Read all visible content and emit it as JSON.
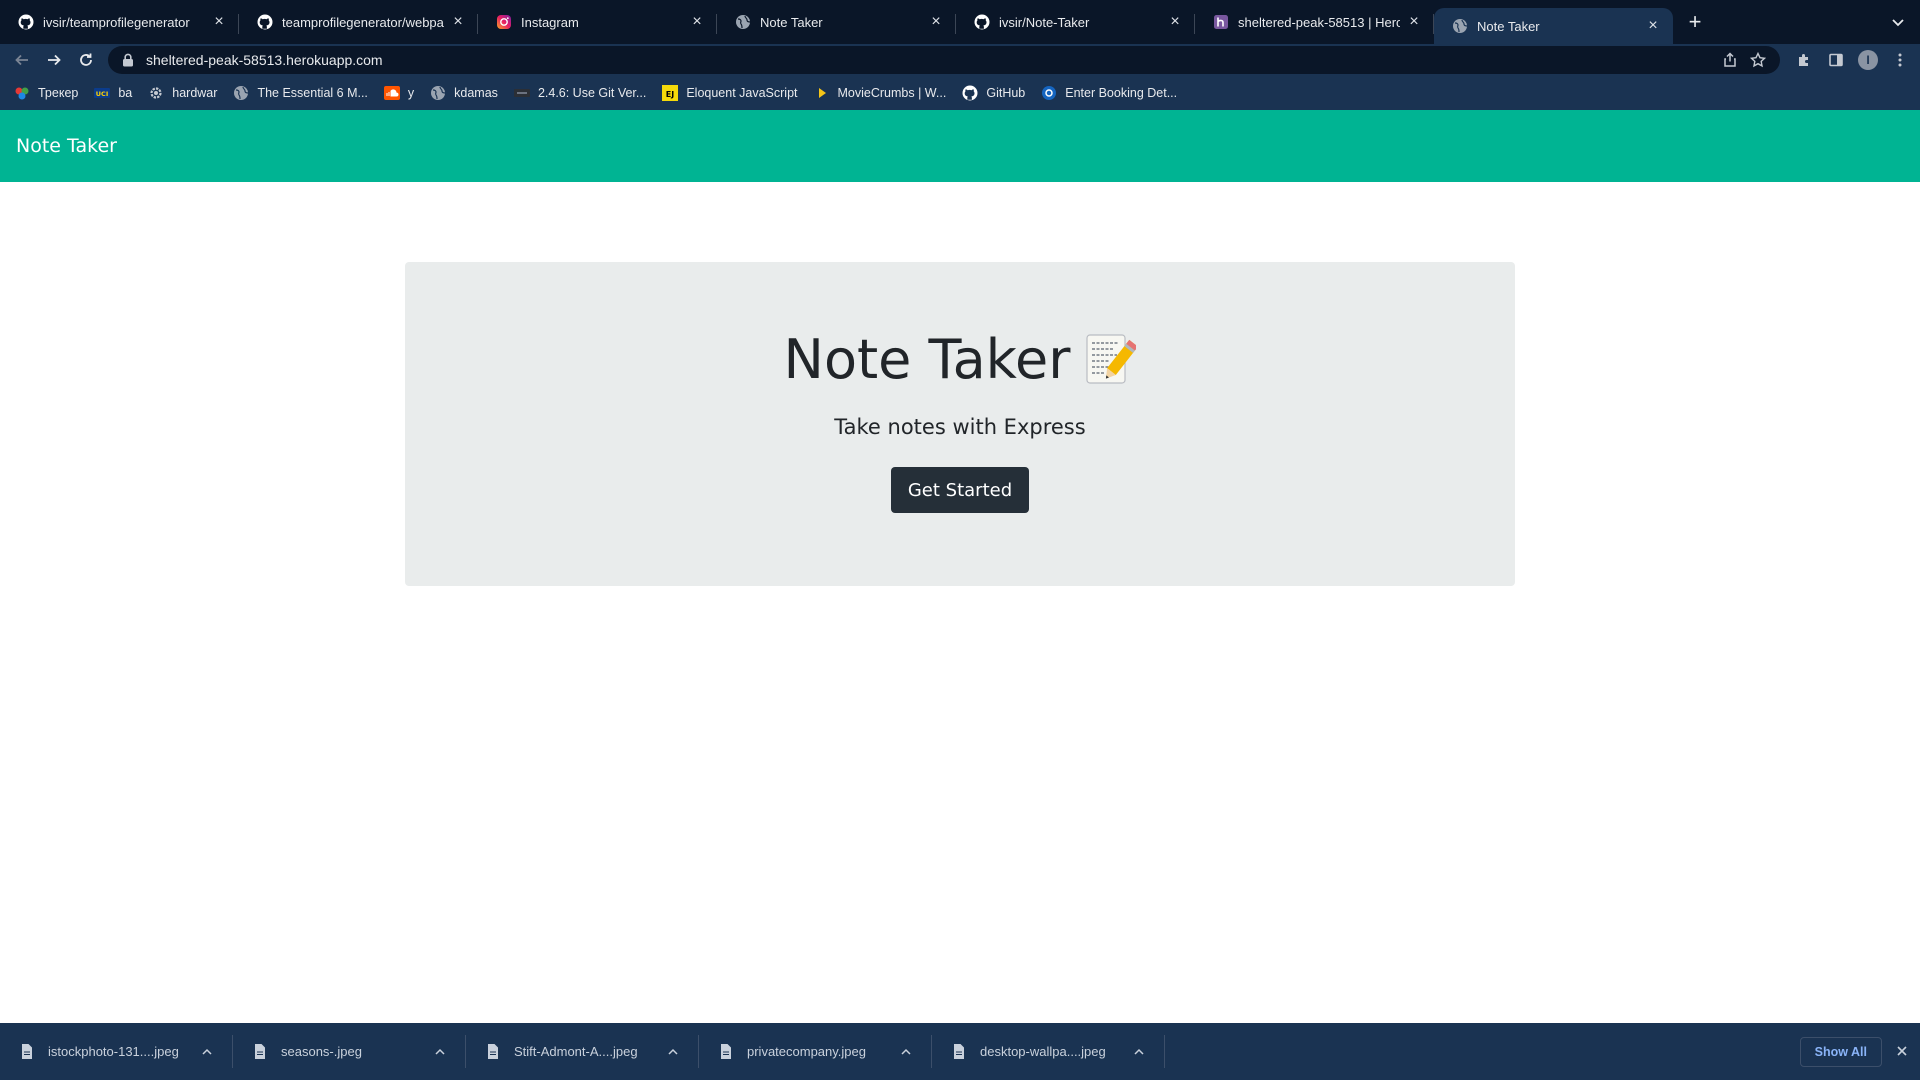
{
  "browser": {
    "tabs": [
      {
        "title": "ivsir/teamprofilegenerator",
        "icon": "github-icon"
      },
      {
        "title": "teamprofilegenerator/webpage",
        "icon": "github-icon"
      },
      {
        "title": "Instagram",
        "icon": "instagram-icon"
      },
      {
        "title": "Note Taker",
        "icon": "globe-icon"
      },
      {
        "title": "ivsir/Note-Taker",
        "icon": "github-icon"
      },
      {
        "title": "sheltered-peak-58513 | Heroku",
        "icon": "heroku-icon"
      },
      {
        "title": "Note Taker",
        "icon": "globe-icon",
        "active": true
      }
    ],
    "address": "sheltered-peak-58513.herokuapp.com",
    "bookmarks": [
      {
        "label": "Трекер",
        "icon": "tracker-icon"
      },
      {
        "label": "ba",
        "icon": "uci-icon"
      },
      {
        "label": "hardwar",
        "icon": "gear-icon"
      },
      {
        "label": "The Essential 6 M...",
        "icon": "globe-icon"
      },
      {
        "label": "y",
        "icon": "soundcloud-icon"
      },
      {
        "label": "kdamas",
        "icon": "globe-icon"
      },
      {
        "label": "2.4.6: Use Git Ver...",
        "icon": "dark-site-icon"
      },
      {
        "label": "Eloquent JavaScript",
        "icon": "js-icon"
      },
      {
        "label": "MovieCrumbs | W...",
        "icon": "play-icon"
      },
      {
        "label": "GitHub",
        "icon": "github-icon"
      },
      {
        "label": "Enter Booking Det...",
        "icon": "booking-icon"
      }
    ],
    "avatar_letter": "I"
  },
  "page": {
    "navbar_brand": "Note Taker",
    "jumbotron": {
      "title": "Note Taker",
      "title_icon": "memo-icon",
      "subtitle": "Take notes with Express",
      "button": "Get Started"
    }
  },
  "downloads": {
    "items": [
      "istockphoto-131....jpeg",
      "seasons-.jpeg",
      "Stift-Admont-A....jpeg",
      "privatecompany.jpeg",
      "desktop-wallpa....jpeg"
    ],
    "show_all": "Show All"
  },
  "colors": {
    "navbar": "#00b493",
    "jumbotron": "#e9ecec",
    "button": "#252f38",
    "browser_frame": "#1a3352"
  }
}
